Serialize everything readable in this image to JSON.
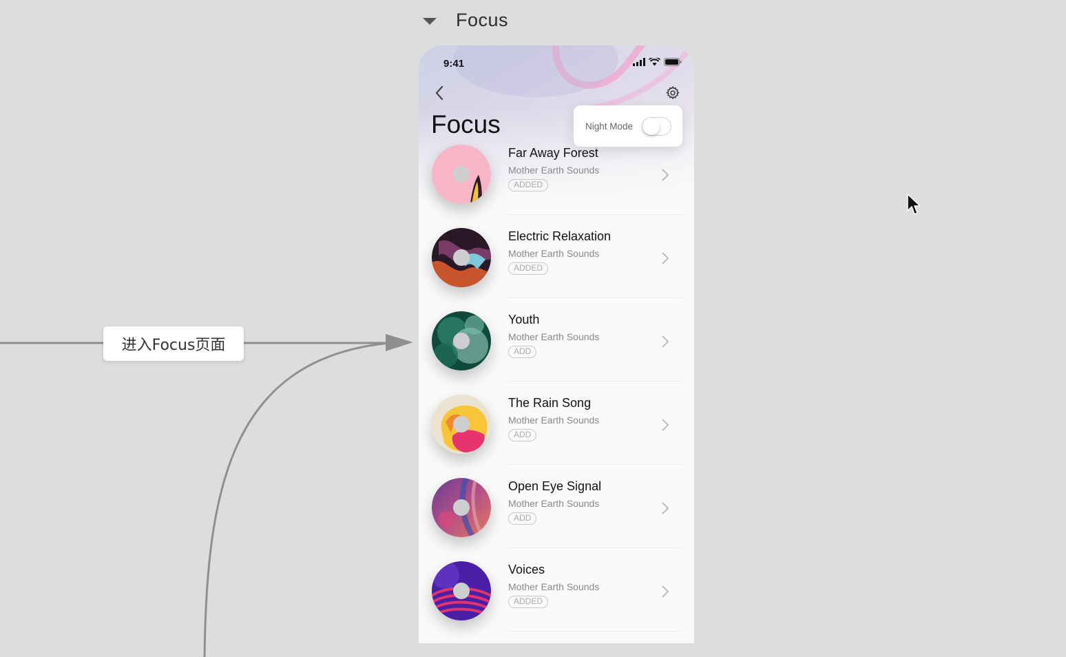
{
  "artboard": {
    "title": "Focus"
  },
  "flow": {
    "label": "进入Focus页面"
  },
  "status_bar": {
    "time": "9:41",
    "icons": [
      "signal-icon",
      "wifi-icon",
      "battery-icon"
    ]
  },
  "header": {
    "title": "Focus",
    "back_icon": "chevron-left-icon",
    "settings_icon": "gear-icon"
  },
  "night_mode": {
    "label": "Night Mode",
    "enabled": false
  },
  "tracks": [
    {
      "title": "Far Away Forest",
      "artist": "Mother Earth Sounds",
      "status": "ADDED"
    },
    {
      "title": "Electric Relaxation",
      "artist": "Mother Earth Sounds",
      "status": "ADDED"
    },
    {
      "title": "Youth",
      "artist": "Mother Earth Sounds",
      "status": "ADD"
    },
    {
      "title": "The Rain Song",
      "artist": "Mother Earth Sounds",
      "status": "ADD"
    },
    {
      "title": "Open Eye Signal",
      "artist": "Mother Earth Sounds",
      "status": "ADD"
    },
    {
      "title": "Voices",
      "artist": "Mother Earth Sounds",
      "status": "ADDED"
    }
  ],
  "colors": {
    "canvas": "#dcdddc",
    "title_text": "#111111",
    "subtitle_text": "#888888",
    "badge_border": "#c8c8c8",
    "connector": "#8f8f8f"
  }
}
